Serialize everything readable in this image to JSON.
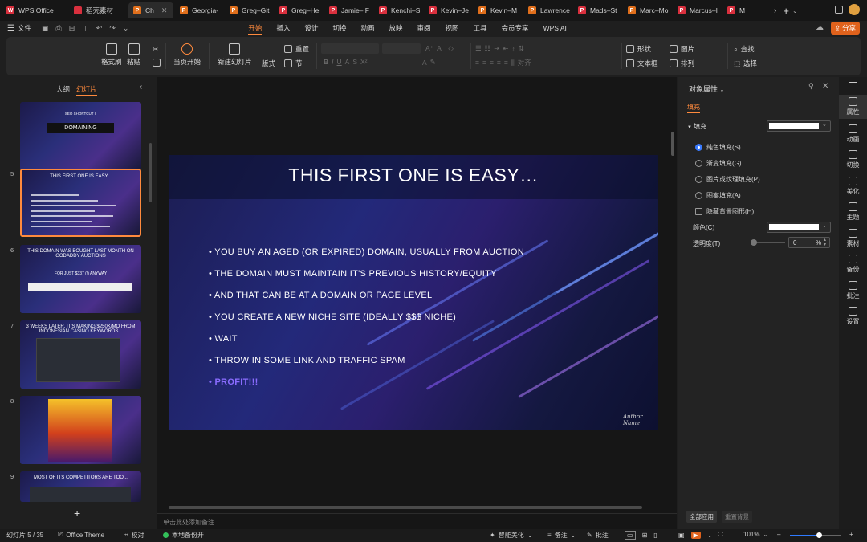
{
  "tabs": [
    {
      "label": "WPS Office",
      "color": "#d9303e",
      "icon": "W"
    },
    {
      "label": "稻壳素材",
      "color": "#d9303e",
      "icon": ""
    },
    {
      "label": "Ch",
      "color": "#e06f1c",
      "icon": "P",
      "active": true
    },
    {
      "label": "Georgia-",
      "color": "#e06f1c",
      "icon": "P"
    },
    {
      "label": "Greg–Git",
      "color": "#e06f1c",
      "icon": "P"
    },
    {
      "label": "Greg–He",
      "color": "#d9303e",
      "icon": "P"
    },
    {
      "label": "Jamie–IF",
      "color": "#d9303e",
      "icon": "P"
    },
    {
      "label": "Kenchi–S",
      "color": "#d9303e",
      "icon": "P"
    },
    {
      "label": "Kevin–Je",
      "color": "#d9303e",
      "icon": "P"
    },
    {
      "label": "Kevin–M",
      "color": "#e06f1c",
      "icon": "P"
    },
    {
      "label": "Lawrence",
      "color": "#e06f1c",
      "icon": "P"
    },
    {
      "label": "Mads–St",
      "color": "#d9303e",
      "icon": "P"
    },
    {
      "label": "Marc–Mo",
      "color": "#e06f1c",
      "icon": "P"
    },
    {
      "label": "Marcus–I",
      "color": "#d9303e",
      "icon": "P"
    },
    {
      "label": "M",
      "color": "#d9303e",
      "icon": "P"
    }
  ],
  "menu": {
    "file": "文件",
    "items": [
      "开始",
      "插入",
      "设计",
      "切换",
      "动画",
      "放映",
      "审阅",
      "视图",
      "工具",
      "会员专享",
      "WPS AI"
    ],
    "active": "开始",
    "share": "分享"
  },
  "ribbon": {
    "format_painter": "格式刷",
    "paste": "粘贴",
    "start_from_current": "当页开始",
    "new_slide": "新建幻灯片",
    "layout": "版式",
    "reset": "重置",
    "section": "节",
    "shape": "形状",
    "textbox": "文本框",
    "picture": "图片",
    "arrange": "排列",
    "find": "查找",
    "select": "选择",
    "align": "对齐"
  },
  "left_panel": {
    "tab_outline": "大纲",
    "tab_slides": "幻灯片",
    "add_label": "+",
    "slides": [
      {
        "num": "",
        "title": "DOMAINING",
        "sub": "SEO SHORTCUT II"
      },
      {
        "num": "5",
        "title": "THIS FIRST ONE IS EASY..."
      },
      {
        "num": "6",
        "title": "THIS DOMAIN WAS BOUGHT LAST MONTH ON GODADDY AUCTIONS",
        "sub": "FOR JUST $337 (!) ANYWAY"
      },
      {
        "num": "7",
        "title": "3 WEEKS LATER, IT'S MAKING $250K/MO FROM INDONESIAN CASINO KEYWORDS..."
      },
      {
        "num": "8",
        "title": ""
      },
      {
        "num": "9",
        "title": "MOST OF ITS COMPETITORS ARE TOO..."
      }
    ]
  },
  "slide": {
    "title": "THIS FIRST ONE IS EASY…",
    "bullets": [
      "• YOU BUY AN AGED (OR EXPIRED) DOMAIN, USUALLY FROM AUCTION",
      "• THE DOMAIN MUST MAINTAIN IT'S PREVIOUS HISTORY/EQUITY",
      "• AND THAT CAN BE AT A DOMAIN OR PAGE LEVEL",
      "• YOU CREATE A NEW NICHE SITE (IDEALLY $$$ NICHE)",
      "• WAIT",
      "• THROW IN SOME LINK AND TRAFFIC SPAM"
    ],
    "highlight_bullet": "• PROFIT!!!",
    "highlight_color": "#8a6cff",
    "signature": "Author Name"
  },
  "notes_placeholder": "单击此处添加备注",
  "right_panel": {
    "title": "对象属性",
    "section": "填充",
    "fill_label": "填充",
    "options": [
      "纯色填充(S)",
      "渐变填充(G)",
      "图片或纹理填充(P)",
      "图案填充(A)"
    ],
    "hide_bg": "隐藏背景图形(H)",
    "color_label": "颜色(C)",
    "transparency_label": "透明度(T)",
    "transparency_value": "0",
    "transparency_unit": "%",
    "apply_all": "全部应用",
    "reset_bg": "重置背景"
  },
  "sidebar": [
    "属性",
    "动画",
    "切换",
    "美化",
    "主题",
    "素材",
    "备份",
    "批注",
    "设置"
  ],
  "status": {
    "slide_counter": "幻灯片 5 / 35",
    "theme": "Office Theme",
    "proof": "校对",
    "backup": "本地备份开",
    "beautify": "智能美化",
    "notes": "备注",
    "comments": "批注",
    "zoom": "101%",
    "zoom_level": 0.56
  }
}
